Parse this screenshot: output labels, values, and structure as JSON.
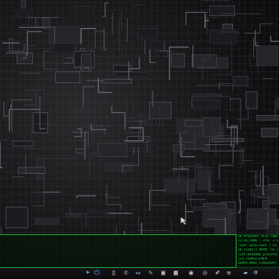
{
  "desktop": {
    "wallpaper": "dark-circuit-board-wallpaper"
  },
  "sysinfo": {
    "accent_color": "#2fd14a",
    "lines": [
      "x6 Attacher SCSI removable",
      "21:26:7086 : sto: 1 IV",
      "\"usb\" auto-sent 7 s3",
      "26.712017] UKVM: no IPVE",
      "list 0558496 procotes",
      "[23.3160S5][MEM",
      "3G8S6.0002 Comnpower"
    ]
  },
  "dock": {
    "icons": [
      {
        "name": "rocket-launcher-icon",
        "glyph": "➤",
        "color": "#8fb5ff"
      },
      {
        "name": "power-icon",
        "glyph": "⏻",
        "color": "#5fa8ff"
      },
      {
        "name": "document-icon",
        "glyph": "▯",
        "color": "#e8e8e8"
      },
      {
        "name": "phone-icon",
        "glyph": "✆",
        "color": "#cfd6e0"
      },
      {
        "name": "monitor-icon",
        "glyph": "▭",
        "color": "#9bc3ff"
      },
      {
        "name": "pen-icon",
        "glyph": "✎",
        "color": "#86d36b"
      },
      {
        "name": "terminal-icon",
        "glyph": "▣",
        "color": "#bfbfbf"
      },
      {
        "name": "calendar-icon",
        "glyph": "▦",
        "color": "#d8d8d8"
      },
      {
        "name": "globe-icon",
        "glyph": "◉",
        "color": "#c7c7c7"
      },
      {
        "name": "disc-icon",
        "glyph": "◎",
        "color": "#aab4c0"
      },
      {
        "name": "text-editor-icon",
        "glyph": "✐",
        "color": "#ffffff"
      },
      {
        "name": "tools-icon",
        "glyph": "⚒",
        "color": "#d0d0d0"
      },
      {
        "name": "folder-icon",
        "glyph": "▰",
        "color": "#8fa9d6"
      },
      {
        "name": "trash-icon",
        "glyph": "⌫",
        "color": "#c0c0c0"
      }
    ]
  }
}
